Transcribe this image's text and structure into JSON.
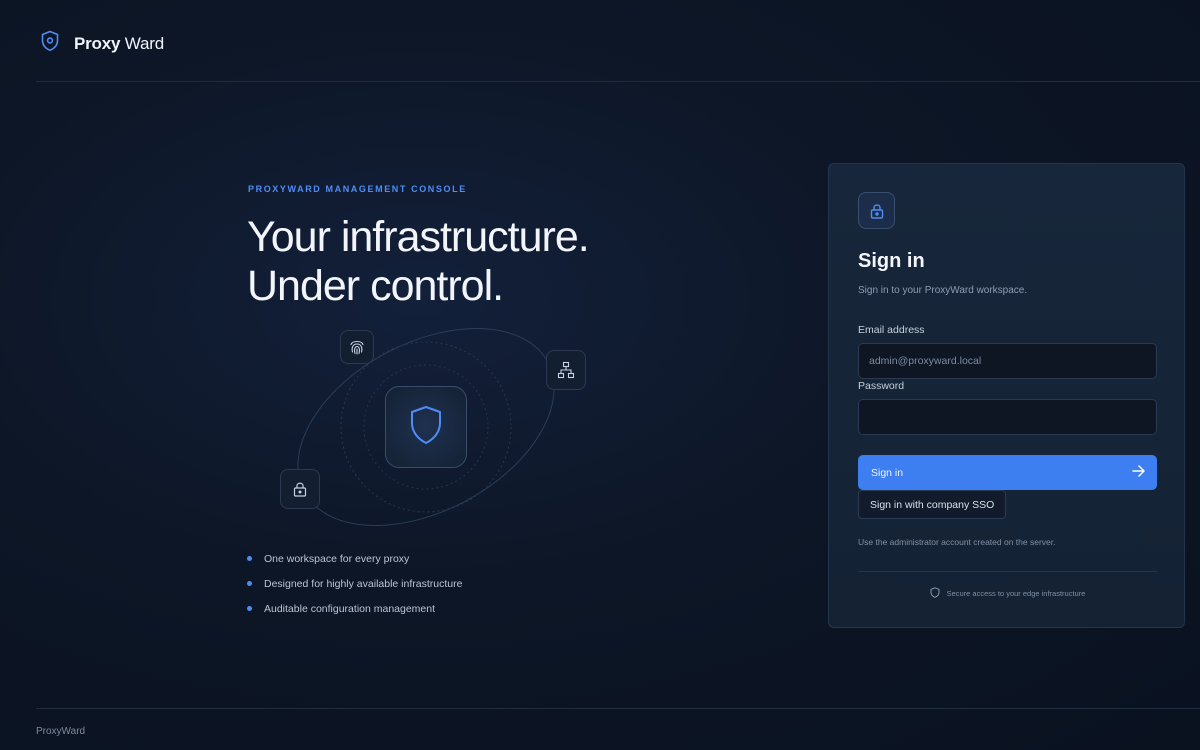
{
  "brand": {
    "name_bold": "Proxy",
    "name_light": "Ward",
    "logo_icon": "shield-icon"
  },
  "hero": {
    "eyebrow": "PROXYWARD MANAGEMENT CONSOLE",
    "headline_line1": "Your infrastructure.",
    "headline_line2": "Under control.",
    "illustration_icons": [
      "shield-icon",
      "fingerprint-icon",
      "network-icon",
      "lock-icon"
    ],
    "features": [
      "One workspace for every proxy",
      "Designed for highly available infrastructure",
      "Auditable configuration management"
    ]
  },
  "signin": {
    "icon": "lock-icon",
    "title": "Sign in",
    "subtitle": "Sign in to your ProxyWard workspace.",
    "email_label": "Email address",
    "email_placeholder": "admin@proxyward.local",
    "email_value": "",
    "password_label": "Password",
    "password_value": "",
    "submit_label": "Sign in",
    "sso_label": "Sign in with company SSO",
    "hint": "Use the administrator account created on the server.",
    "secure_note": "Secure access to your edge infrastructure"
  },
  "footer": {
    "text": "ProxyWard"
  },
  "colors": {
    "accent": "#3d7ff0",
    "background": "#0d1626",
    "card": "#17263a"
  }
}
